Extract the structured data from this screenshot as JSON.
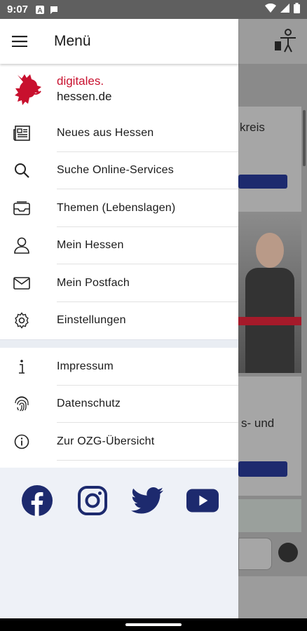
{
  "status_bar": {
    "time": "9:07"
  },
  "header": {
    "title": "Menü",
    "menu_icon": "hamburger-icon"
  },
  "brand": {
    "line1": "digitales.",
    "line2": "hessen.de"
  },
  "menu_items": [
    {
      "label": "Neues aus Hessen",
      "icon": "newspaper-icon"
    },
    {
      "label": "Suche Online-Services",
      "icon": "search-icon"
    },
    {
      "label": "Themen (Lebenslagen)",
      "icon": "inbox-tray-icon"
    },
    {
      "label": "Mein Hessen",
      "icon": "person-icon"
    },
    {
      "label": "Mein Postfach",
      "icon": "mail-icon"
    },
    {
      "label": "Einstellungen",
      "icon": "gear-icon"
    }
  ],
  "secondary_items": [
    {
      "label": "Impressum",
      "icon": "info-icon"
    },
    {
      "label": "Datenschutz",
      "icon": "fingerprint-icon"
    },
    {
      "label": "Zur OZG-Übersicht",
      "icon": "info-circle-icon"
    }
  ],
  "social": [
    "facebook-icon",
    "instagram-icon",
    "twitter-icon",
    "youtube-icon"
  ],
  "background": {
    "card1_text": "kreis",
    "card2_text": "s- und"
  },
  "colors": {
    "brand_red": "#c8102e",
    "social_blue": "#1d2a6e"
  }
}
